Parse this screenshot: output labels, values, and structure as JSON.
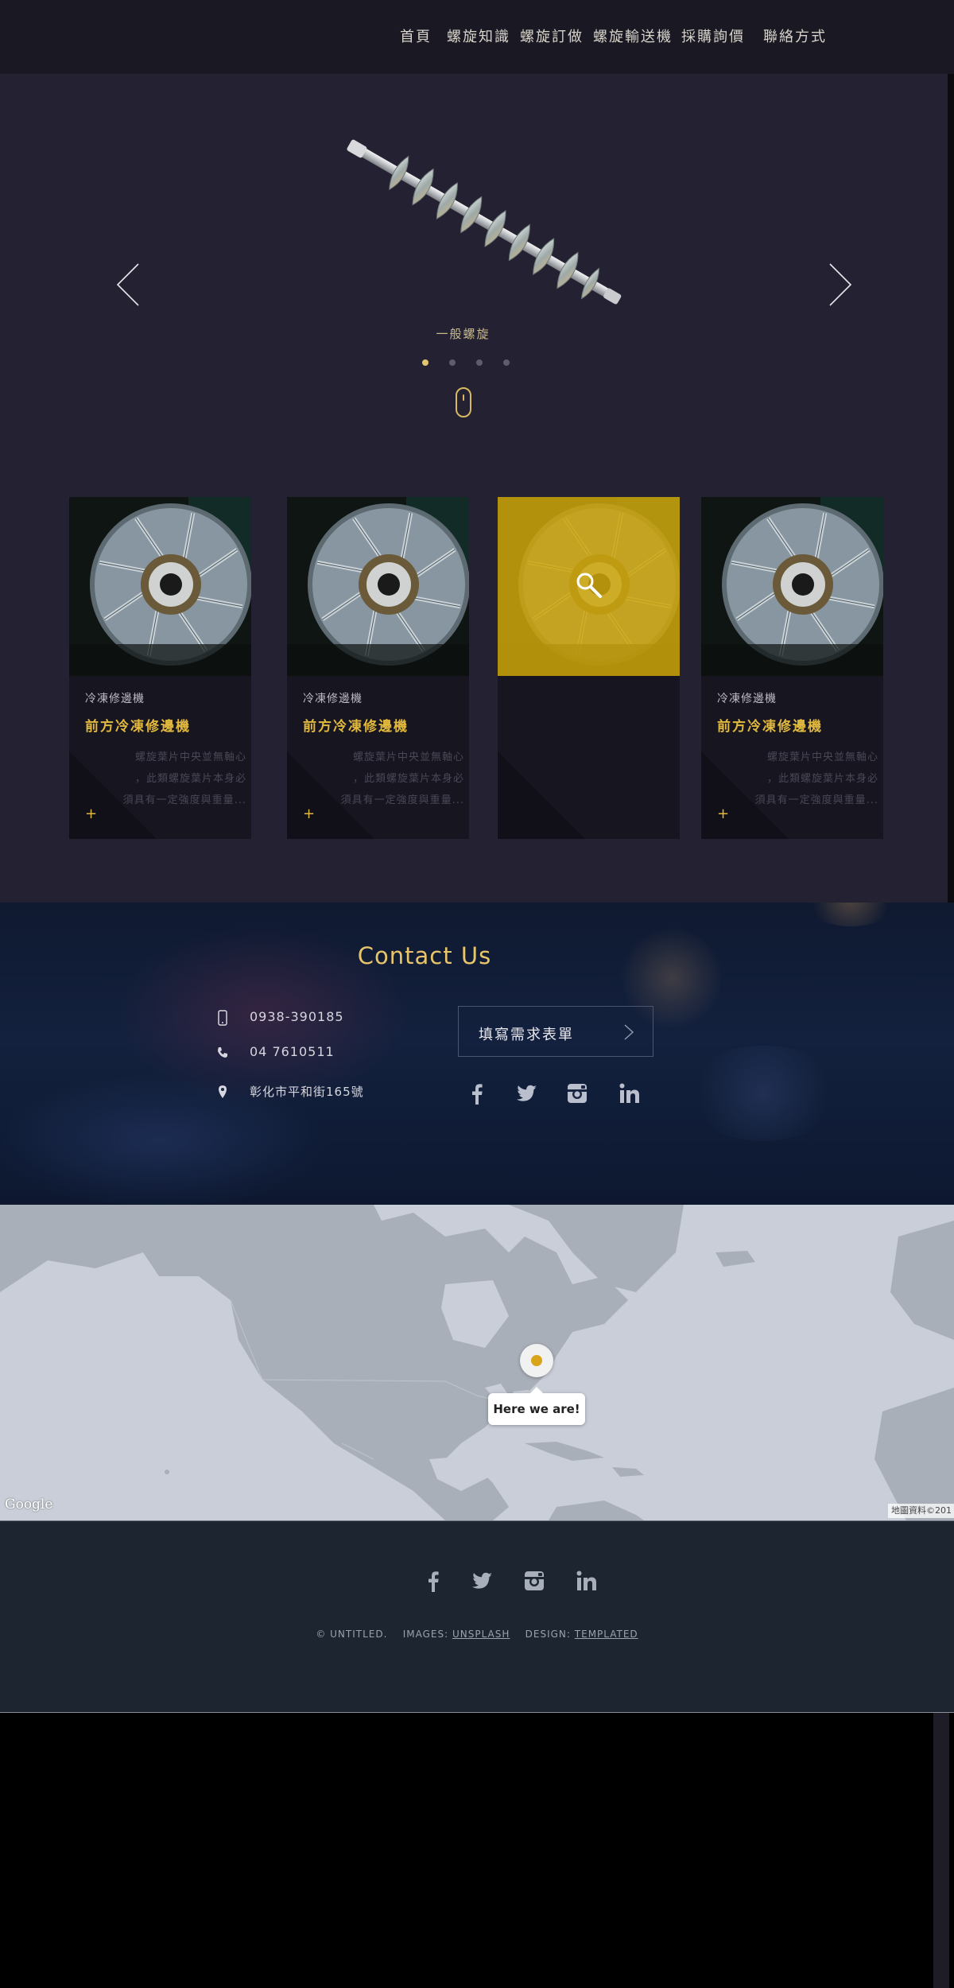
{
  "nav": {
    "items": [
      "首頁",
      "螺旋知識",
      "螺旋訂做",
      "螺旋輸送機",
      "採購詢價",
      "聯絡方式"
    ]
  },
  "hero": {
    "slide_caption": "一般螺旋",
    "slide_count": 4,
    "active_slide": 1
  },
  "cards": [
    {
      "category": "冷凍修邊機",
      "title": "前方冷凍修邊機",
      "desc": [
        "螺旋葉片中央並無軸心",
        "，此類螺旋葉片本身必",
        "須具有一定強度與重量..."
      ],
      "hovered": false
    },
    {
      "category": "冷凍修邊機",
      "title": "前方冷凍修邊機",
      "desc": [
        "螺旋葉片中央並無軸心",
        "，此類螺旋葉片本身必",
        "須具有一定強度與重量..."
      ],
      "hovered": false
    },
    {
      "category": "",
      "title": "",
      "desc": [],
      "hovered": true
    },
    {
      "category": "冷凍修邊機",
      "title": "前方冷凍修邊機",
      "desc": [
        "螺旋葉片中央並無軸心",
        "，此類螺旋葉片本身必",
        "須具有一定強度與重量..."
      ],
      "hovered": false
    }
  ],
  "contact": {
    "title": "Contact Us",
    "mobile": "0938-390185",
    "phone": "04 7610511",
    "address": "彰化市平和街165號",
    "form_button": "填寫需求表單"
  },
  "map": {
    "marker_label": "Here we are!",
    "logo": "Google",
    "credit": "地圖資料©201"
  },
  "footer": {
    "copyright": "© UNTITLED.",
    "images_label": "IMAGES:",
    "images_link": "UNSPLASH",
    "design_label": "DESIGN:",
    "design_link": "TEMPLATED"
  },
  "colors": {
    "accent": "#e2b93f",
    "nav_bg": "#1a1822",
    "main_bg": "#242232",
    "footer_bg": "#1d2630",
    "map_water": "#c9ced8",
    "map_land": "#a9afb9"
  },
  "icons": [
    "chevron-left-icon",
    "chevron-right-icon",
    "mouse-scroll-icon",
    "search-icon",
    "mobile-phone-icon",
    "phone-icon",
    "map-pin-icon",
    "chevron-right-icon",
    "facebook-icon",
    "twitter-icon",
    "instagram-icon",
    "linkedin-icon"
  ]
}
